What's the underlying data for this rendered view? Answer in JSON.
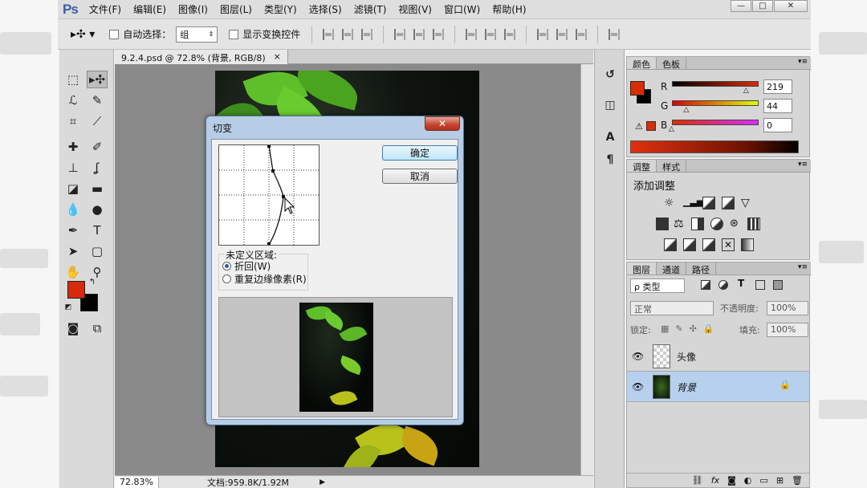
{
  "menubar": {
    "logo": "Ps",
    "items": [
      "文件(F)",
      "编辑(E)",
      "图像(I)",
      "图层(L)",
      "类型(Y)",
      "选择(S)",
      "滤镜(T)",
      "视图(V)",
      "窗口(W)",
      "帮助(H)"
    ],
    "window_buttons": [
      "—",
      "□",
      "✕"
    ]
  },
  "options": {
    "move_icon": "move-tool-icon",
    "auto_select_label": "自动选择：",
    "auto_select_value": "组",
    "show_transform_label": "显示变换控件"
  },
  "document": {
    "tab_title": "9.2.4.psd @ 72.8% (背景, RGB/8)",
    "tab_close": "×",
    "zoom": "72.83%",
    "doc_size": "文档:959.8K/1.92M",
    "arrow": "▶"
  },
  "dialog": {
    "title": "切变",
    "close": "✕",
    "ok": "确定",
    "cancel": "取消",
    "undefined_area_label": "未定义区域:",
    "option_wrap": "折回(W)",
    "option_repeat": "重复边缘像素(R)",
    "selected_option": "wrap"
  },
  "toolbox": {
    "foreground_color": "#d62a0c",
    "background_color": "#000000"
  },
  "color_panel": {
    "tabs": [
      "颜色",
      "色板"
    ],
    "r_label": "R",
    "g_label": "G",
    "b_label": "B",
    "r_value": "219",
    "g_value": "44",
    "b_value": "0",
    "foreground": "#db2c00",
    "r_level": 0.86,
    "g_level": 0.17,
    "b_level": 0.0
  },
  "adjustments_panel": {
    "tabs": [
      "调整",
      "样式"
    ],
    "heading": "添加调整"
  },
  "layers_panel": {
    "tabs": [
      "图层",
      "通道",
      "路径"
    ],
    "filter_label": "ρ 类型",
    "blend_mode": "正常",
    "opacity_label": "不透明度:",
    "opacity_value": "100%",
    "lock_label": "锁定:",
    "fill_label": "填充:",
    "fill_value": "100%",
    "layers": [
      {
        "name": "头像",
        "selected": false
      },
      {
        "name": "背景",
        "selected": true
      }
    ],
    "footer_icons": [
      "link-icon",
      "fx-icon",
      "mask-icon",
      "adjustment-icon",
      "folder-icon",
      "new-layer-icon",
      "trash-icon"
    ]
  },
  "strip": {
    "items": [
      "history-icon",
      "properties-icon",
      "character-icon",
      "paragraph-icon"
    ]
  }
}
